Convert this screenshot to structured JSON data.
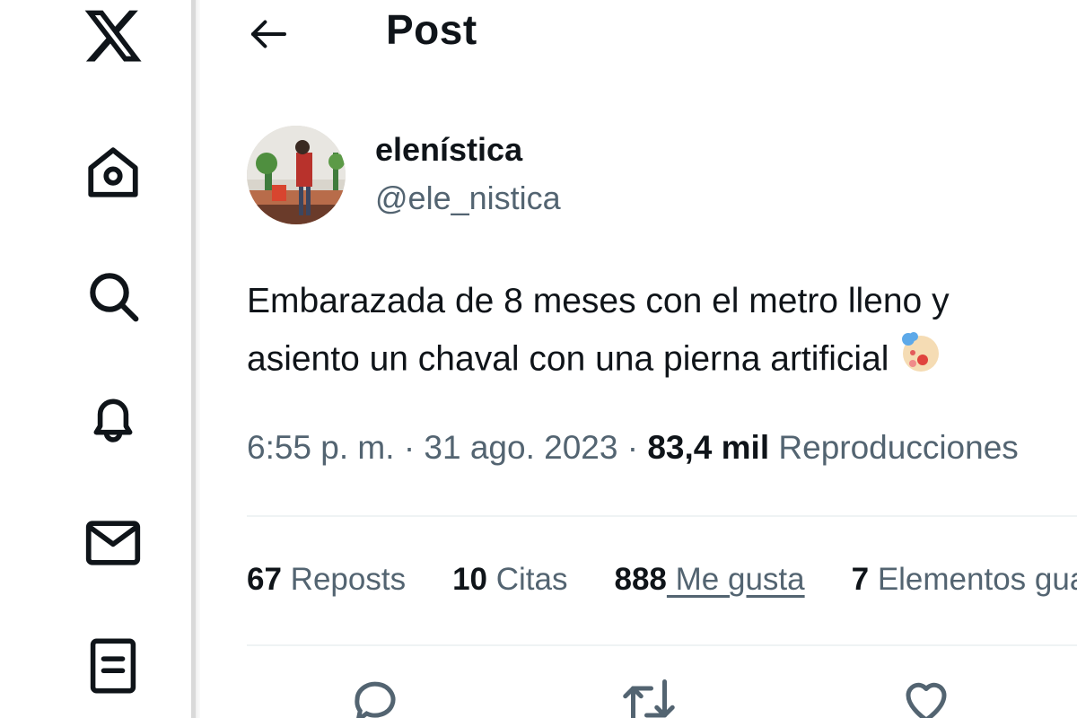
{
  "nav": {
    "items": [
      {
        "name": "x-logo-icon",
        "label": "X"
      },
      {
        "name": "home-icon",
        "label": "Home"
      },
      {
        "name": "search-icon",
        "label": "Explore"
      },
      {
        "name": "bell-icon",
        "label": "Notifications"
      },
      {
        "name": "mail-icon",
        "label": "Messages"
      },
      {
        "name": "list-icon",
        "label": "Lists"
      }
    ]
  },
  "header": {
    "back_icon": "arrow-left-icon",
    "title": "Post"
  },
  "post": {
    "author": {
      "display_name": "elenística",
      "handle": "@ele_nistica"
    },
    "text_lines": [
      "Embarazada de 8 meses con el metro lleno y",
      "asiento un chaval con una pierna artificial"
    ],
    "emoji": "clown-face-icon",
    "time": "6:55 p. m.",
    "sep": "·",
    "date": "31 ago. 2023",
    "views_count": "83,4 mil",
    "views_label": "Reproducciones"
  },
  "stats": {
    "reposts": {
      "count": "67",
      "label": "Reposts"
    },
    "quotes": {
      "count": "10",
      "label": "Citas"
    },
    "likes": {
      "count": "888",
      "label": " Me gusta"
    },
    "bookmarks": {
      "count": "7",
      "label": "Elementos guardados"
    }
  },
  "actions": [
    "reply-icon",
    "repost-icon",
    "like-icon"
  ],
  "colors": {
    "text": "#0f1419",
    "secondary": "#536471",
    "divider": "#eff3f4"
  }
}
